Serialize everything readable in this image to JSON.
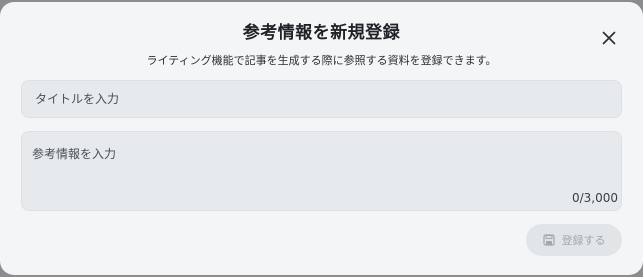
{
  "modal": {
    "title": "参考情報を新規登録",
    "subtitle": "ライティング機能で記事を生成する際に参照する資料を登録できます。"
  },
  "form": {
    "title_placeholder": "タイトルを入力",
    "title_value": "",
    "content_placeholder": "参考情報を入力",
    "content_value": "",
    "counter": "0/3,000"
  },
  "actions": {
    "submit_label": "登録する",
    "submit_icon": "save-icon",
    "close_icon": "close-icon"
  }
}
